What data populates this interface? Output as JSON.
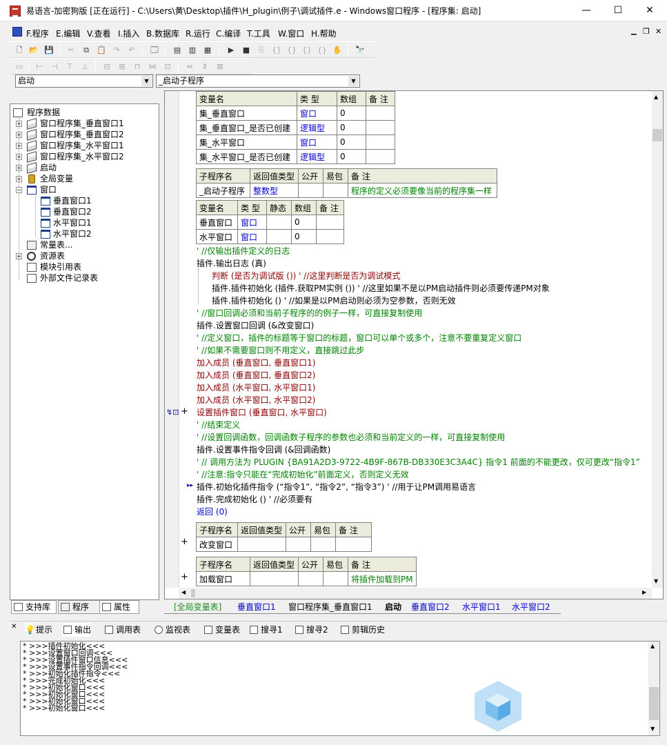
{
  "window": {
    "title": "易语言-加密狗版 [正在运行] - C:\\Users\\黄\\Desktop\\插件\\H_plugin\\例子\\调试插件.e - Windows窗口程序 - [程序集: 启动]",
    "min": "—",
    "max": "☐",
    "close": "✕"
  },
  "menu": [
    "F.程序",
    "E.编辑",
    "V.查看",
    "I.插入",
    "B.数据库",
    "R.运行",
    "C.编译",
    "T.工具",
    "W.窗口",
    "H.帮助"
  ],
  "combos": {
    "left": "启动",
    "right": "_启动子程序"
  },
  "tree": {
    "root": "程序数据",
    "items": [
      "窗口程序集_垂直窗口1",
      "窗口程序集_垂直窗口2",
      "窗口程序集_水平窗口1",
      "窗口程序集_水平窗口2",
      "启动",
      "全局变量",
      "窗口",
      "垂直窗口1",
      "垂直窗口2",
      "水平窗口1",
      "水平窗口2",
      "常量表...",
      "资源表",
      "模块引用表",
      "外部文件记录表"
    ]
  },
  "lefttabs": [
    "支持库",
    "程序",
    "属性"
  ],
  "vartable1": {
    "headers": [
      "变量名",
      "类 型",
      "数组",
      "备 注"
    ],
    "rows": [
      [
        "集_垂直窗口",
        "窗口",
        "0",
        ""
      ],
      [
        "集_垂直窗口_是否已创建",
        "逻辑型",
        "0",
        ""
      ],
      [
        "集_水平窗口",
        "窗口",
        "0",
        ""
      ],
      [
        "集_水平窗口_是否已创建",
        "逻辑型",
        "0",
        ""
      ]
    ]
  },
  "subtable1": {
    "headers": [
      "子程序名",
      "返回值类型",
      "公开",
      "易包",
      "备 注"
    ],
    "row": [
      "_启动子程序",
      "整数型",
      "",
      "",
      "程序的定义必须要像当前的程序集一样"
    ]
  },
  "vartable2": {
    "headers": [
      "变量名",
      "类 型",
      "静态",
      "数组",
      "备 注"
    ],
    "rows": [
      [
        "垂直窗口",
        "窗口",
        "",
        "0",
        ""
      ],
      [
        "水平窗口",
        "窗口",
        "",
        "0",
        ""
      ]
    ]
  },
  "code": [
    "' //仅输出插件定义的日志",
    "插件.输出日志 (真)",
    "判断 (是否为调试版 ()) ' //这里判断是否为调试模式",
    "插件.插件初始化 (插件.获取PM实例 ()) ' //这里如果不是以PM启动插件则必须要传递PM对象",
    "插件.插件初始化 () ' //如果是以PM启动则必须为空参数，否则无效",
    "' //窗口回调必须和当前子程序的的例子一样，可直接复制使用",
    "插件.设置窗口回调 (&改变窗口)",
    "' //定义窗口，插件的标题等于窗口的标题，窗口可以单个或多个，注意不要重复定义窗口",
    "' //如果不需要窗口则不用定义，直接跳过此步",
    "加入成员 (垂直窗口, 垂直窗口1)",
    "加入成员 (垂直窗口, 垂直窗口2)",
    "加入成员 (水平窗口, 水平窗口1)",
    "加入成员 (水平窗口, 水平窗口2)",
    "设置插件窗口 (垂直窗口, 水平窗口)",
    "' //结束定义",
    "' //设置回调函数，回调函数子程序的参数也必须和当前定义的一样，可直接复制使用",
    "插件.设置事件指令回调 (&回调函数)",
    "' // 调用方法为 PLUGIN {BA91A2D3-9722-4B9F-867B-DB330E3C3A4C} 指令1   前面的不能更改，仅可更改“指令1”",
    "' //注意:指令只能在“完成初始化”前面定义，否则定义无效",
    "插件.初始化插件指令 (“指令1”, “指令2”, “指令3”) ' //用于让PM调用易语言",
    "插件.完成初始化 () ' //必须要有",
    "返回 (0)"
  ],
  "subtable2": {
    "headers": [
      "子程序名",
      "返回值类型",
      "公开",
      "易包",
      "备 注"
    ],
    "row": [
      "改变窗口",
      "",
      "",
      "",
      ""
    ]
  },
  "subtable3": {
    "headers": [
      "子程序名",
      "返回值类型",
      "公开",
      "易包",
      "备 注"
    ],
    "row": [
      "加载窗口",
      "",
      "",
      "",
      "将插件加载到PM"
    ]
  },
  "bottomtabs": [
    "[全局变量表]",
    "垂直窗口1",
    "窗口程序集_垂直窗口1",
    "启动",
    "垂直窗口2",
    "水平窗口1",
    "水平窗口2"
  ],
  "outtabs": [
    "提示",
    "输出",
    "调用表",
    "监视表",
    "变量表",
    "搜寻1",
    "搜寻2",
    "剪辑历史"
  ],
  "output": [
    "* >>>插件初始化<<<",
    "* >>>设置窗口回调<<<",
    "* >>>设置插件窗口信息<<<",
    "* >>>设置事件指令回调<<<",
    "* >>>初始化插件指令<<<",
    "* >>>完成初始化<<<",
    "* >>>初始化窗口<<<",
    "* >>>初始化窗口<<<",
    "* >>>初始化窗口<<<",
    "* >>>初始化窗口<<<"
  ]
}
